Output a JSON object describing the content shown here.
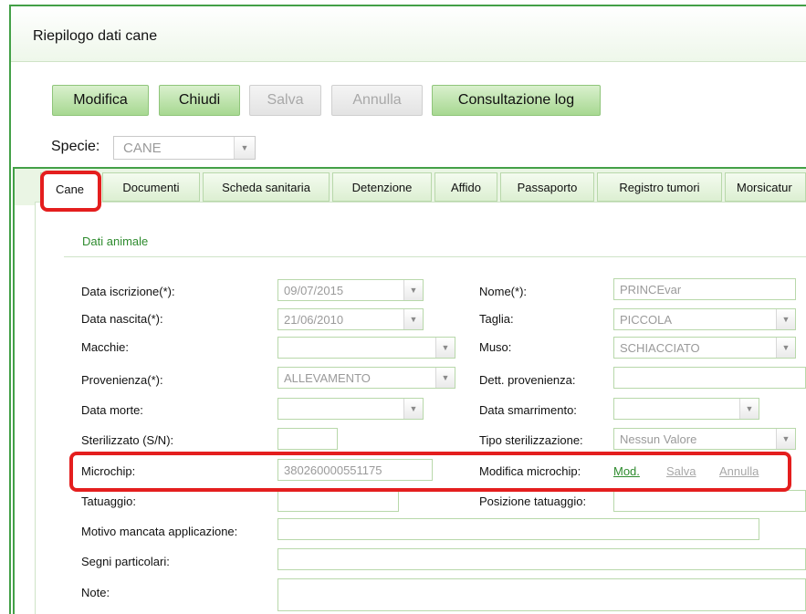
{
  "window": {
    "title": "Riepilogo dati cane"
  },
  "toolbar": {
    "modifica": "Modifica",
    "chiudi": "Chiudi",
    "salva": "Salva",
    "annulla": "Annulla",
    "consultazione_log": "Consultazione log"
  },
  "specie": {
    "label": "Specie:",
    "value": "CANE"
  },
  "tabs": [
    "Cane",
    "Documenti",
    "Scheda sanitaria",
    "Detenzione",
    "Affido",
    "Passaporto",
    "Registro tumori",
    "Morsicatur"
  ],
  "section": "Dati animale",
  "form": {
    "data_iscrizione": {
      "label": "Data iscrizione(*):",
      "value": "09/07/2015"
    },
    "data_nascita": {
      "label": "Data nascita(*):",
      "value": "21/06/2010"
    },
    "macchie": {
      "label": "Macchie:",
      "value": ""
    },
    "provenienza": {
      "label": "Provenienza(*):",
      "value": "ALLEVAMENTO"
    },
    "data_morte": {
      "label": "Data morte:",
      "value": ""
    },
    "sterilizzato": {
      "label": "Sterilizzato (S/N):",
      "value": ""
    },
    "microchip": {
      "label": "Microchip:",
      "value": "380260000551175"
    },
    "tatuaggio": {
      "label": "Tatuaggio:",
      "value": ""
    },
    "motivo": {
      "label": "Motivo mancata applicazione:",
      "value": ""
    },
    "segni": {
      "label": "Segni particolari:",
      "value": ""
    },
    "note": {
      "label": "Note:",
      "value": ""
    },
    "nome": {
      "label": "Nome(*):",
      "value": "PRINCEvar"
    },
    "taglia": {
      "label": "Taglia:",
      "value": "PICCOLA"
    },
    "muso": {
      "label": "Muso:",
      "value": "SCHIACCIATO"
    },
    "dett_provenienza": {
      "label": "Dett. provenienza:",
      "value": ""
    },
    "data_smarrimento": {
      "label": "Data smarrimento:",
      "value": ""
    },
    "tipo_sterilizzazione": {
      "label": "Tipo sterilizzazione:",
      "value": "Nessun Valore"
    },
    "modifica_microchip": {
      "label": "Modifica microchip:",
      "mod": "Mod.",
      "salva": "Salva",
      "annulla": "Annulla"
    },
    "posizione_tatuaggio": {
      "label": "Posizione tatuaggio:",
      "value": ""
    }
  },
  "colors": {
    "accent": "#43a047",
    "highlight": "#e41e1e",
    "link": "#2e8b2e",
    "disabled": "#a8a8a8"
  }
}
